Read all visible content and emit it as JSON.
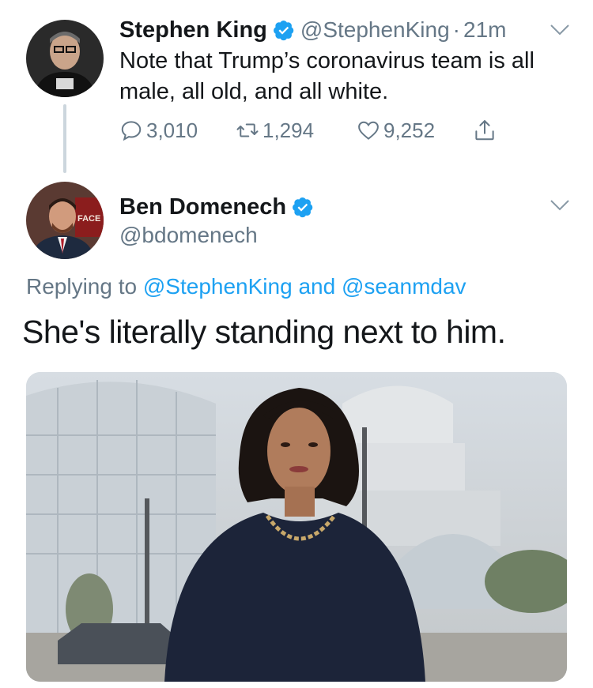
{
  "tweet1": {
    "author_name": "Stephen King",
    "handle": "@StephenKing",
    "separator": "·",
    "time": "21m",
    "text": "Note that Trump’s coronavirus team is all male, all old, and all white.",
    "avatar_icon": "user-avatar-photo",
    "actions": {
      "reply_count": "3,010",
      "retweet_count": "1,294",
      "like_count": "9,252",
      "reply_icon": "reply-icon",
      "retweet_icon": "retweet-icon",
      "like_icon": "heart-icon",
      "share_icon": "share-icon"
    }
  },
  "tweet2": {
    "author_name": "Ben Domenech",
    "handle": "@bdomenech",
    "replying_prefix": "Replying to",
    "replying_user1": "@StephenKing",
    "replying_and": "and",
    "replying_user2": "@seanmdav",
    "text": "She's literally standing next to him.",
    "avatar_icon": "user-avatar-photo",
    "avatar_sign_text": "FACE",
    "media_icon": "photo-woman-capitol"
  },
  "colors": {
    "text_primary": "#14171a",
    "text_secondary": "#657786",
    "link": "#1da1f2",
    "verified": "#1da1f2",
    "thread_line": "#ccd6dd"
  }
}
